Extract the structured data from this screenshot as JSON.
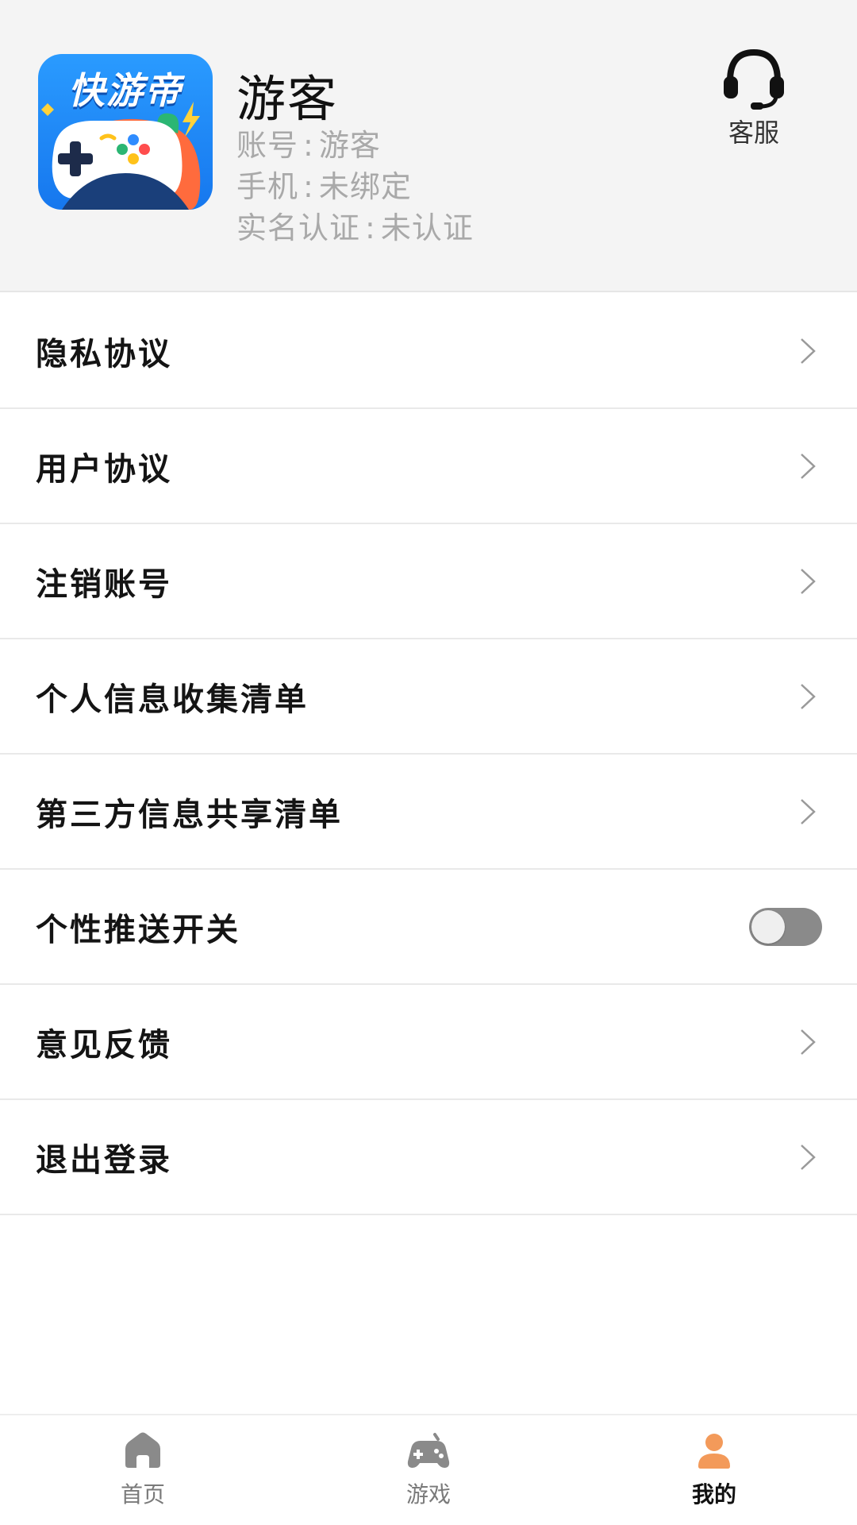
{
  "profile": {
    "logo_text": "快游帝",
    "name": "游客",
    "account_label": "账号",
    "account_value": "游客",
    "phone_label": "手机",
    "phone_value": "未绑定",
    "realname_label": "实名认证",
    "realname_value": "未认证",
    "info_separator": ":",
    "service_label": "客服"
  },
  "menu": {
    "items": [
      {
        "label": "隐私协议",
        "control": "chevron"
      },
      {
        "label": "用户协议",
        "control": "chevron"
      },
      {
        "label": "注销账号",
        "control": "chevron"
      },
      {
        "label": "个人信息收集清单",
        "control": "chevron"
      },
      {
        "label": "第三方信息共享清单",
        "control": "chevron"
      },
      {
        "label": "个性推送开关",
        "control": "toggle",
        "toggle_on": false
      },
      {
        "label": "意见反馈",
        "control": "chevron"
      },
      {
        "label": "退出登录",
        "control": "chevron"
      }
    ]
  },
  "tabbar": {
    "tabs": [
      {
        "label": "首页",
        "icon": "home-icon",
        "active": false
      },
      {
        "label": "游戏",
        "icon": "gamepad-icon",
        "active": false
      },
      {
        "label": "我的",
        "icon": "user-icon",
        "active": true
      }
    ],
    "active_color": "#f39a5a",
    "inactive_color": "#8a8a8a"
  },
  "colors": {
    "header_bg": "#f4f4f4",
    "logo_blue": "#1677ee",
    "toggle_off": "#8a8a8a"
  }
}
